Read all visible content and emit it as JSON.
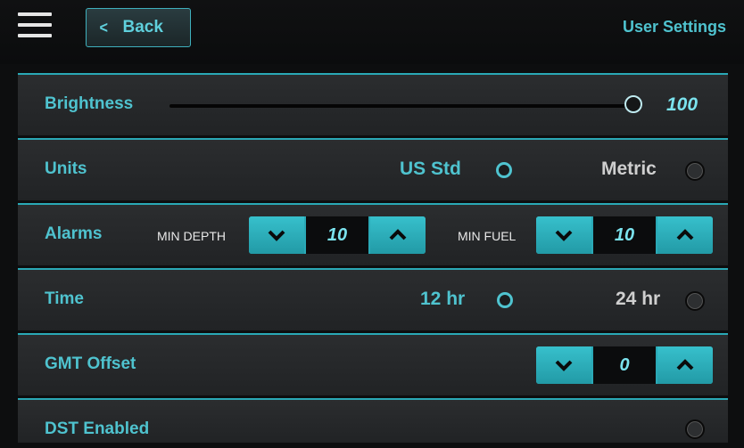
{
  "header": {
    "back_label": "Back",
    "title": "User Settings"
  },
  "brightness": {
    "label": "Brightness",
    "value": "100",
    "level": 1.0
  },
  "units": {
    "label": "Units",
    "options": [
      {
        "label": "US Std",
        "selected": true
      },
      {
        "label": "Metric",
        "selected": false
      }
    ]
  },
  "alarms": {
    "label": "Alarms",
    "min_depth": {
      "label": "MIN DEPTH",
      "value": "10"
    },
    "min_fuel": {
      "label": "MIN FUEL",
      "value": "10"
    }
  },
  "time": {
    "label": "Time",
    "options": [
      {
        "label": "12 hr",
        "selected": true
      },
      {
        "label": "24 hr",
        "selected": false
      }
    ]
  },
  "gmt": {
    "label": "GMT Offset",
    "value": "0"
  },
  "dst": {
    "label": "DST Enabled",
    "enabled": false
  },
  "colors": {
    "accent": "#2aa9b6",
    "text": "#4fc3cf",
    "background": "#0d0e0f"
  }
}
